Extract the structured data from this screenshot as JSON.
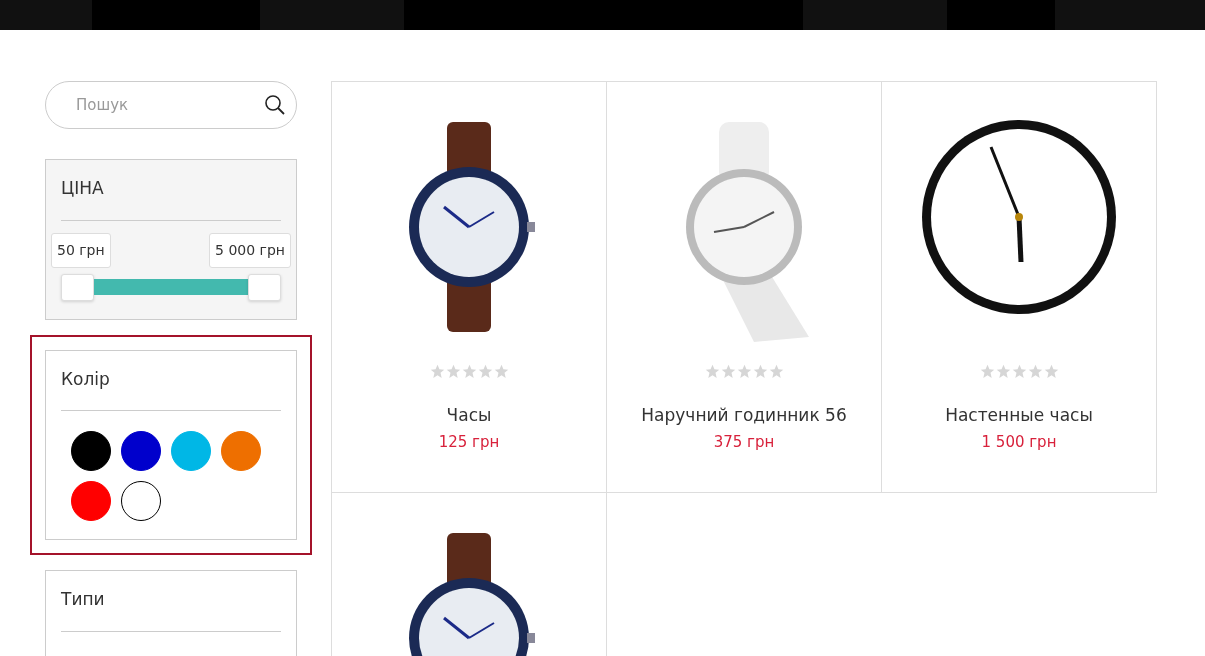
{
  "search": {
    "placeholder": "Пошук"
  },
  "filters": [
    {
      "kind": "price",
      "title": "ЦІНА",
      "highlighted": false,
      "min": "50 грн",
      "max": "5 000 грн",
      "level": 1
    },
    {
      "kind": "colors",
      "title": "Колір",
      "highlighted": true,
      "colors": [
        {
          "color": "#000000"
        },
        {
          "color": "#0000cc"
        },
        {
          "color": "#00b7e6"
        },
        {
          "color": "#ee6f00"
        },
        {
          "color": "#ff0000"
        },
        {
          "color": "#ffffff"
        }
      ]
    },
    {
      "kind": "types",
      "title": "Типи",
      "highlighted": false
    }
  ],
  "products": [
    {
      "kind": "dark-wristwatch",
      "name": "Часы",
      "price": "125 грн",
      "stars": 0
    },
    {
      "kind": "white-wristwatch",
      "name": "Наручний годинник 56",
      "price": "375 грн",
      "stars": 0
    },
    {
      "kind": "wall-clock",
      "name": "Настенные часы",
      "price": "1 500 грн",
      "stars": 0
    },
    {
      "kind": "dark-wristwatch"
    }
  ]
}
